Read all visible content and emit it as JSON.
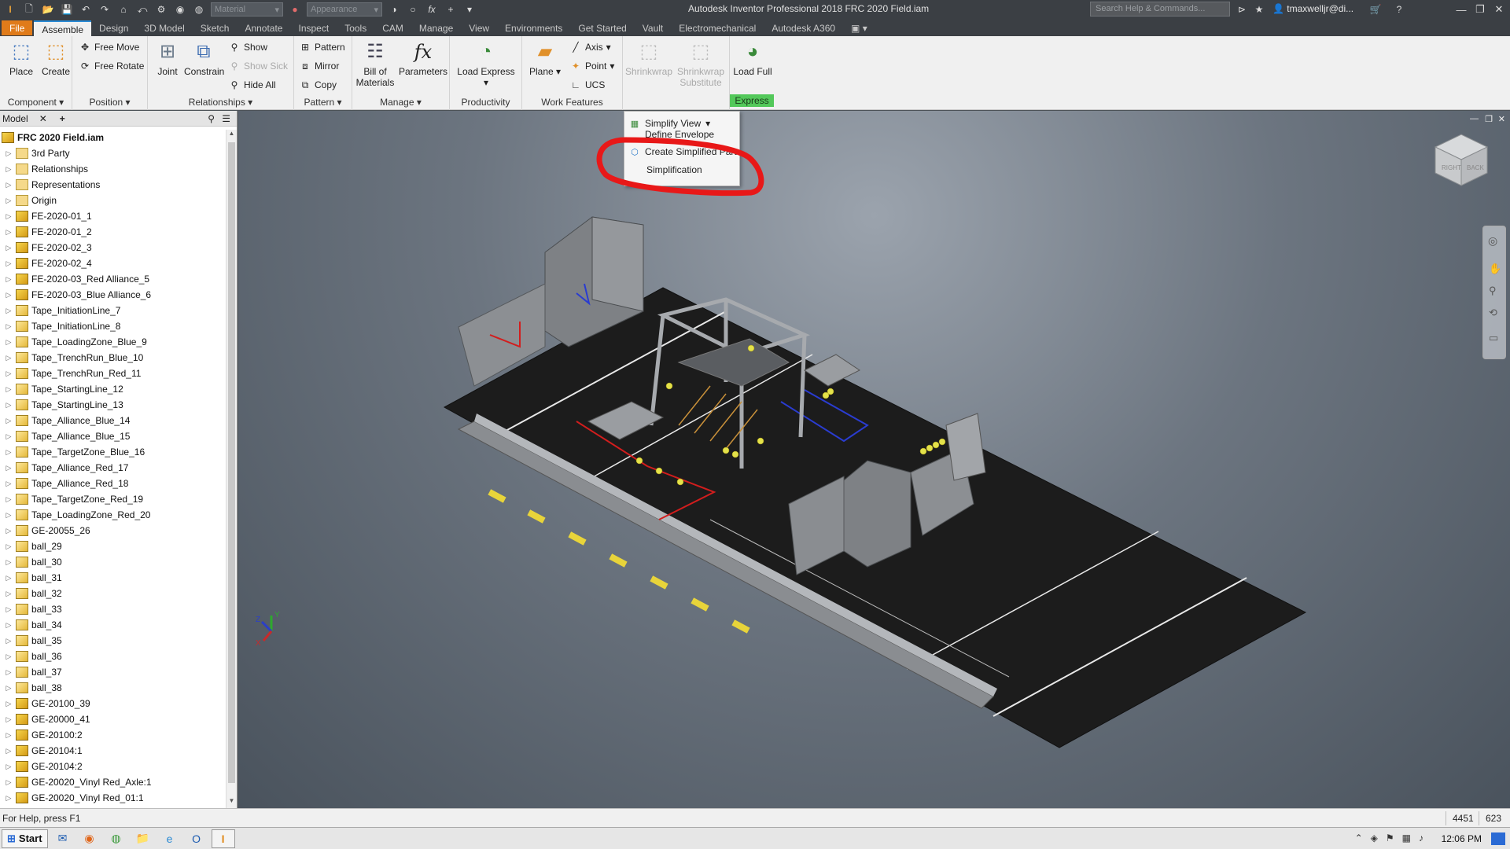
{
  "titlebar": {
    "material_combo": "Material",
    "appearance_combo": "Appearance",
    "title": "Autodesk Inventor Professional 2018    FRC 2020 Field.iam",
    "search_placeholder": "Search Help & Commands...",
    "user": "tmaxwelljr@di..."
  },
  "tabs": [
    "File",
    "Assemble",
    "Design",
    "3D Model",
    "Sketch",
    "Annotate",
    "Inspect",
    "Tools",
    "CAM",
    "Manage",
    "View",
    "Environments",
    "Get Started",
    "Vault",
    "Electromechanical",
    "Autodesk A360"
  ],
  "ribbon": {
    "component": {
      "label": "Component",
      "place": "Place",
      "create": "Create"
    },
    "position": {
      "label": "Position",
      "free_move": "Free Move",
      "free_rotate": "Free Rotate"
    },
    "relationships": {
      "label": "Relationships",
      "joint": "Joint",
      "constrain": "Constrain",
      "show": "Show",
      "show_sick": "Show Sick",
      "hide_all": "Hide All"
    },
    "pattern": {
      "label": "Pattern",
      "pattern": "Pattern",
      "mirror": "Mirror",
      "copy": "Copy"
    },
    "manage": {
      "label": "Manage",
      "bom_line1": "Bill of",
      "bom_line2": "Materials",
      "parameters": "Parameters"
    },
    "productivity": {
      "label": "Productivity",
      "load_express": "Load Express"
    },
    "work_features": {
      "label": "Work Features",
      "plane": "Plane",
      "axis": "Axis",
      "point": "Point",
      "ucs": "UCS"
    },
    "simplification": {
      "shrinkwrap": "Shrinkwrap",
      "shrinkwrap_substitute_line1": "Shrinkwrap",
      "shrinkwrap_substitute_line2": "Substitute"
    },
    "express": {
      "label": "Express",
      "load_full": "Load Full"
    }
  },
  "dropdown": {
    "simplify_view": "Simplify View",
    "define_envelope": "Define Envelope",
    "create_simplified_part": "Create Simplified Part",
    "simplification": "Simplification"
  },
  "browser": {
    "tab_label": "Model",
    "root": "FRC 2020 Field.iam",
    "items": [
      {
        "name": "3rd Party",
        "icon": "folder"
      },
      {
        "name": "Relationships",
        "icon": "folder"
      },
      {
        "name": "Representations",
        "icon": "folder"
      },
      {
        "name": "Origin",
        "icon": "folder"
      },
      {
        "name": "FE-2020-01_1",
        "icon": "asm"
      },
      {
        "name": "FE-2020-01_2",
        "icon": "asm"
      },
      {
        "name": "FE-2020-02_3",
        "icon": "asm"
      },
      {
        "name": "FE-2020-02_4",
        "icon": "asm"
      },
      {
        "name": "FE-2020-03_Red Alliance_5",
        "icon": "asm"
      },
      {
        "name": "FE-2020-03_Blue Alliance_6",
        "icon": "asm"
      },
      {
        "name": "Tape_InitiationLine_7",
        "icon": "part"
      },
      {
        "name": "Tape_InitiationLine_8",
        "icon": "part"
      },
      {
        "name": "Tape_LoadingZone_Blue_9",
        "icon": "part"
      },
      {
        "name": "Tape_TrenchRun_Blue_10",
        "icon": "part"
      },
      {
        "name": "Tape_TrenchRun_Red_11",
        "icon": "part"
      },
      {
        "name": "Tape_StartingLine_12",
        "icon": "part"
      },
      {
        "name": "Tape_StartingLine_13",
        "icon": "part"
      },
      {
        "name": "Tape_Alliance_Blue_14",
        "icon": "part"
      },
      {
        "name": "Tape_Alliance_Blue_15",
        "icon": "part"
      },
      {
        "name": "Tape_TargetZone_Blue_16",
        "icon": "part"
      },
      {
        "name": "Tape_Alliance_Red_17",
        "icon": "part"
      },
      {
        "name": "Tape_Alliance_Red_18",
        "icon": "part"
      },
      {
        "name": "Tape_TargetZone_Red_19",
        "icon": "part"
      },
      {
        "name": "Tape_LoadingZone_Red_20",
        "icon": "part"
      },
      {
        "name": "GE-20055_26",
        "icon": "part"
      },
      {
        "name": "ball_29",
        "icon": "part"
      },
      {
        "name": "ball_30",
        "icon": "part"
      },
      {
        "name": "ball_31",
        "icon": "part"
      },
      {
        "name": "ball_32",
        "icon": "part"
      },
      {
        "name": "ball_33",
        "icon": "part"
      },
      {
        "name": "ball_34",
        "icon": "part"
      },
      {
        "name": "ball_35",
        "icon": "part"
      },
      {
        "name": "ball_36",
        "icon": "part"
      },
      {
        "name": "ball_37",
        "icon": "part"
      },
      {
        "name": "ball_38",
        "icon": "part"
      },
      {
        "name": "GE-20100_39",
        "icon": "asm"
      },
      {
        "name": "GE-20000_41",
        "icon": "asm"
      },
      {
        "name": "GE-20100:2",
        "icon": "asm"
      },
      {
        "name": "GE-20104:1",
        "icon": "asm"
      },
      {
        "name": "GE-20104:2",
        "icon": "asm"
      },
      {
        "name": "GE-20020_Vinyl Red_Axle:1",
        "icon": "asm"
      },
      {
        "name": "GE-20020_Vinyl Red_01:1",
        "icon": "asm"
      }
    ]
  },
  "viewcube": {
    "face_right": "RIGHT",
    "face_back": "BACK"
  },
  "triad": {
    "x": "X",
    "y": "Y",
    "z": "Z"
  },
  "statusbar": {
    "help": "For Help, press F1",
    "count1": "4451",
    "count2": "623"
  },
  "taskbar": {
    "start": "Start",
    "clock": "12:06 PM"
  },
  "colors": {
    "accent": "#2a8ad4",
    "file_tab": "#e07b1a",
    "express": "#53c85a",
    "highlight": "#e81818"
  }
}
